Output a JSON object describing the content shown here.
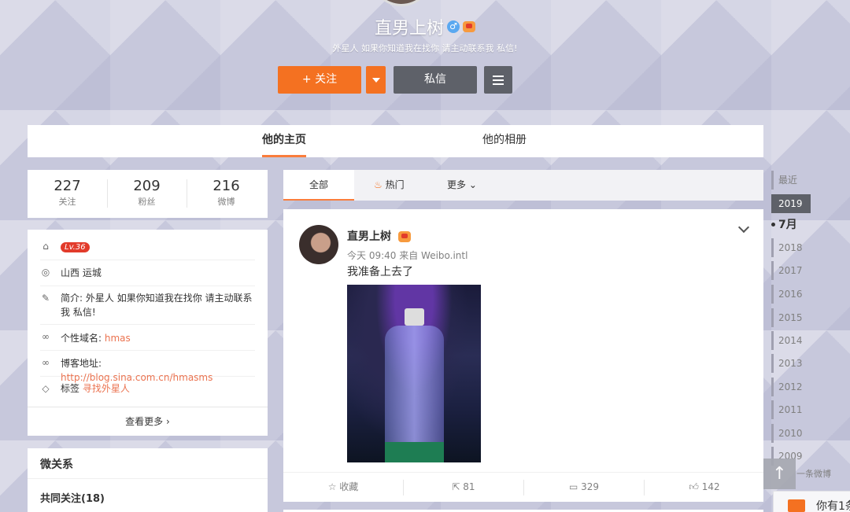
{
  "profile": {
    "name": "直男上树",
    "bio": "外星人 如果你知道我在找你 请主动联系我 私信!",
    "follow_label": "关注",
    "follow_plus": "+",
    "message_label": "私信"
  },
  "tabs": [
    {
      "label": "他的主页",
      "active": true
    },
    {
      "label": "他的相册",
      "active": false
    }
  ],
  "stats": [
    {
      "value": "227",
      "label": "关注"
    },
    {
      "value": "209",
      "label": "粉丝"
    },
    {
      "value": "216",
      "label": "微博"
    }
  ],
  "info": {
    "level": "Lv.36",
    "location": "山西 运城",
    "intro_label": "简介:",
    "intro": "外星人 如果你知道我在找你 请主动联系我 私信!",
    "domain_label": "个性域名:",
    "domain": "hmas",
    "blog_label": "博客地址:",
    "blog": "http://blog.sina.com.cn/hmasms",
    "tags_label": "标签",
    "tags": "寻找外星人",
    "see_more": "查看更多"
  },
  "relations": {
    "title": "微关系",
    "common": "共同关注(18)"
  },
  "feed_tabs": [
    {
      "label": "全部",
      "active": true
    },
    {
      "label": "热门",
      "active": false
    },
    {
      "label": "更多",
      "active": false
    }
  ],
  "post": {
    "author": "直男上树",
    "meta": "今天 09:40 来自 Weibo.intl",
    "text": "我准备上去了",
    "actions": {
      "collect": "收藏",
      "repost": "81",
      "comment": "329",
      "like": "142"
    }
  },
  "timeline": {
    "recent": "最近",
    "current_year": "2019",
    "current_month": "7月",
    "years": [
      "2018",
      "2017",
      "2016",
      "2015",
      "2014",
      "2013",
      "2012",
      "2011",
      "2010",
      "2009"
    ],
    "partial_label": "一条微博"
  },
  "toast": {
    "text": "你有1条"
  },
  "colors": {
    "accent": "#f47121",
    "link": "#eb7350",
    "dark_button": "#5e6169"
  }
}
